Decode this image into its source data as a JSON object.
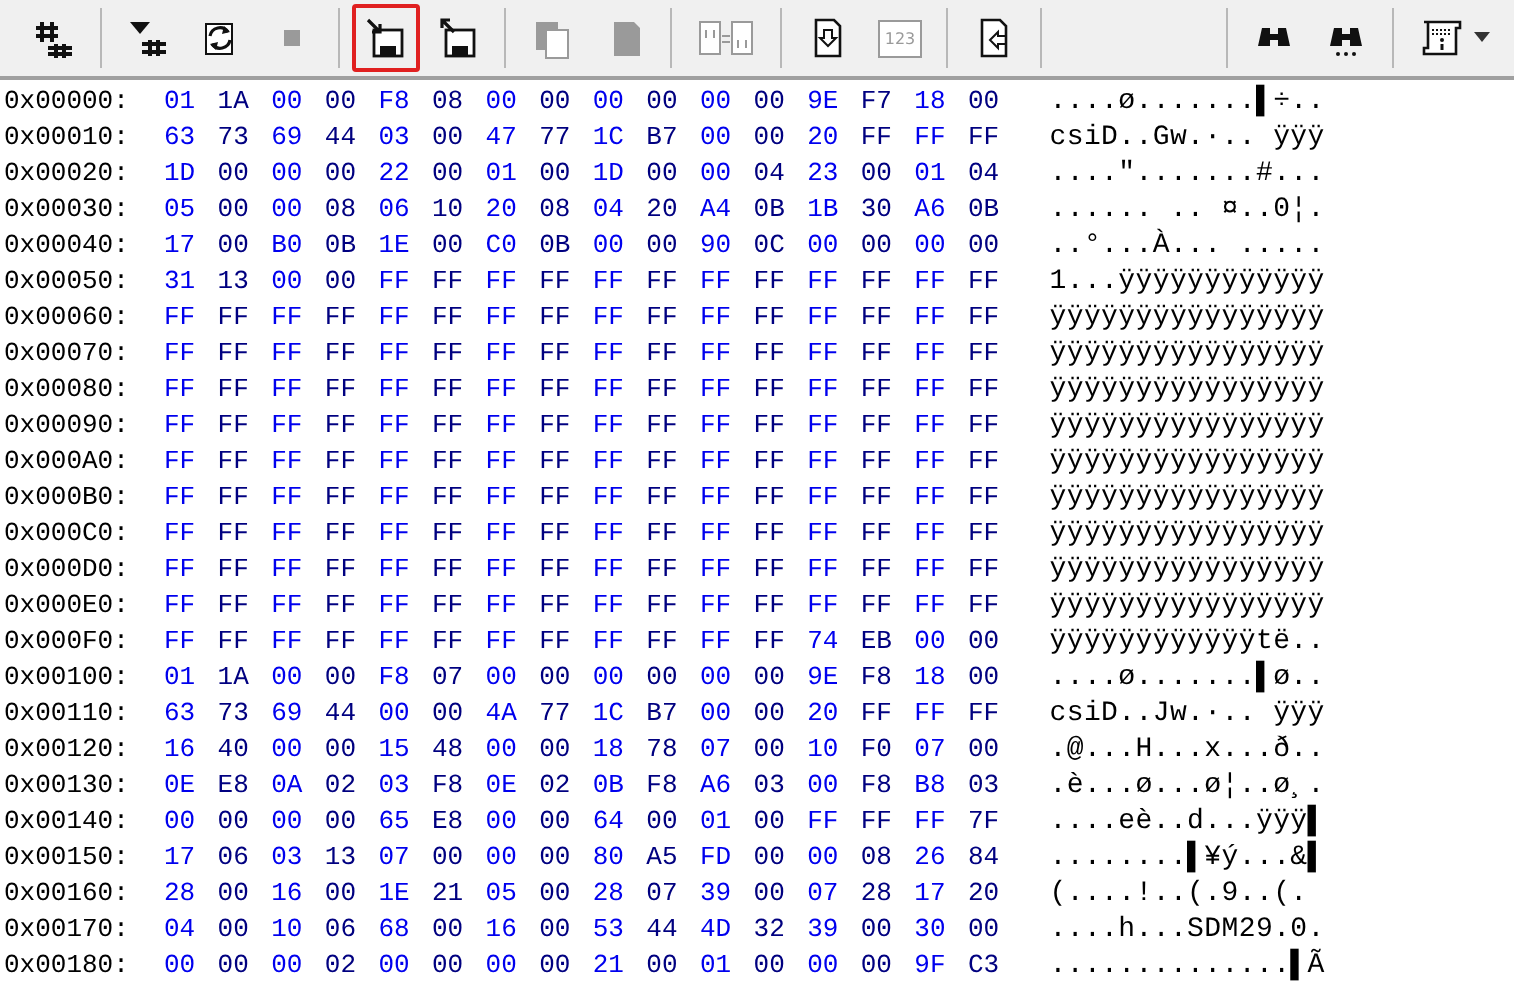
{
  "toolbar": {
    "groups": [
      {
        "buttons": [
          {
            "kind": "hash",
            "disabled": false,
            "highlighted": false
          }
        ]
      },
      {
        "buttons": [
          {
            "kind": "insert",
            "disabled": false,
            "highlighted": false
          },
          {
            "kind": "rotate",
            "disabled": false,
            "highlighted": false
          },
          {
            "kind": "stop",
            "disabled": true,
            "highlighted": false
          }
        ]
      },
      {
        "buttons": [
          {
            "kind": "save-in",
            "disabled": false,
            "highlighted": true
          },
          {
            "kind": "save-out",
            "disabled": false,
            "highlighted": false
          }
        ]
      },
      {
        "buttons": [
          {
            "kind": "copy",
            "disabled": true,
            "highlighted": false
          },
          {
            "kind": "paste",
            "disabled": true,
            "highlighted": false
          }
        ]
      },
      {
        "buttons": [
          {
            "kind": "compare",
            "disabled": true,
            "highlighted": false
          }
        ]
      },
      {
        "buttons": [
          {
            "kind": "doc-down",
            "disabled": false,
            "highlighted": false
          },
          {
            "kind": "numbers",
            "label": "123",
            "disabled": true,
            "highlighted": false
          }
        ]
      },
      {
        "buttons": [
          {
            "kind": "doc-left",
            "disabled": false,
            "highlighted": false
          }
        ]
      },
      {
        "spacer": true,
        "buttons": [
          {
            "kind": "binoculars",
            "disabled": false,
            "highlighted": false
          },
          {
            "kind": "binoculars-next",
            "disabled": false,
            "highlighted": false
          }
        ]
      },
      {
        "buttons": [
          {
            "kind": "info-scroll",
            "disabled": false,
            "highlighted": false,
            "dropdown": true
          }
        ]
      }
    ]
  },
  "rows": [
    {
      "offset": "0x00000:",
      "bytes": "01 1A 00 00 F8 08 00 00 00 00 00 00 9E F7 18 00",
      "text": "....ø.......▌÷.."
    },
    {
      "offset": "0x00010:",
      "bytes": "63 73 69 44 03 00 47 77 1C B7 00 00 20 FF FF FF",
      "text": "csiD..Gw.·.. ÿÿÿ"
    },
    {
      "offset": "0x00020:",
      "bytes": "1D 00 00 00 22 00 01 00 1D 00 00 04 23 00 01 04",
      "text": "....\".......#..."
    },
    {
      "offset": "0x00030:",
      "bytes": "05 00 00 08 06 10 20 08 04 20 A4 0B 1B 30 A6 0B",
      "text": "...... .. ¤..0¦."
    },
    {
      "offset": "0x00040:",
      "bytes": "17 00 B0 0B 1E 00 C0 0B 00 00 90 0C 00 00 00 00",
      "text": "..°...À... ....."
    },
    {
      "offset": "0x00050:",
      "bytes": "31 13 00 00 FF FF FF FF FF FF FF FF FF FF FF FF",
      "text": "1...ÿÿÿÿÿÿÿÿÿÿÿÿ"
    },
    {
      "offset": "0x00060:",
      "bytes": "FF FF FF FF FF FF FF FF FF FF FF FF FF FF FF FF",
      "text": "ÿÿÿÿÿÿÿÿÿÿÿÿÿÿÿÿ"
    },
    {
      "offset": "0x00070:",
      "bytes": "FF FF FF FF FF FF FF FF FF FF FF FF FF FF FF FF",
      "text": "ÿÿÿÿÿÿÿÿÿÿÿÿÿÿÿÿ"
    },
    {
      "offset": "0x00080:",
      "bytes": "FF FF FF FF FF FF FF FF FF FF FF FF FF FF FF FF",
      "text": "ÿÿÿÿÿÿÿÿÿÿÿÿÿÿÿÿ"
    },
    {
      "offset": "0x00090:",
      "bytes": "FF FF FF FF FF FF FF FF FF FF FF FF FF FF FF FF",
      "text": "ÿÿÿÿÿÿÿÿÿÿÿÿÿÿÿÿ"
    },
    {
      "offset": "0x000A0:",
      "bytes": "FF FF FF FF FF FF FF FF FF FF FF FF FF FF FF FF",
      "text": "ÿÿÿÿÿÿÿÿÿÿÿÿÿÿÿÿ"
    },
    {
      "offset": "0x000B0:",
      "bytes": "FF FF FF FF FF FF FF FF FF FF FF FF FF FF FF FF",
      "text": "ÿÿÿÿÿÿÿÿÿÿÿÿÿÿÿÿ"
    },
    {
      "offset": "0x000C0:",
      "bytes": "FF FF FF FF FF FF FF FF FF FF FF FF FF FF FF FF",
      "text": "ÿÿÿÿÿÿÿÿÿÿÿÿÿÿÿÿ"
    },
    {
      "offset": "0x000D0:",
      "bytes": "FF FF FF FF FF FF FF FF FF FF FF FF FF FF FF FF",
      "text": "ÿÿÿÿÿÿÿÿÿÿÿÿÿÿÿÿ"
    },
    {
      "offset": "0x000E0:",
      "bytes": "FF FF FF FF FF FF FF FF FF FF FF FF FF FF FF FF",
      "text": "ÿÿÿÿÿÿÿÿÿÿÿÿÿÿÿÿ"
    },
    {
      "offset": "0x000F0:",
      "bytes": "FF FF FF FF FF FF FF FF FF FF FF FF 74 EB 00 00",
      "text": "ÿÿÿÿÿÿÿÿÿÿÿÿtë.."
    },
    {
      "offset": "0x00100:",
      "bytes": "01 1A 00 00 F8 07 00 00 00 00 00 00 9E F8 18 00",
      "text": "....ø.......▌ø.."
    },
    {
      "offset": "0x00110:",
      "bytes": "63 73 69 44 00 00 4A 77 1C B7 00 00 20 FF FF FF",
      "text": "csiD..Jw.·.. ÿÿÿ"
    },
    {
      "offset": "0x00120:",
      "bytes": "16 40 00 00 15 48 00 00 18 78 07 00 10 F0 07 00",
      "text": ".@...H...x...ð.."
    },
    {
      "offset": "0x00130:",
      "bytes": "0E E8 0A 02 03 F8 0E 02 0B F8 A6 03 00 F8 B8 03",
      "text": ".è...ø...ø¦..ø¸."
    },
    {
      "offset": "0x00140:",
      "bytes": "00 00 00 00 65 E8 00 00 64 00 01 00 FF FF FF 7F",
      "text": "....eè..d...ÿÿÿ▌"
    },
    {
      "offset": "0x00150:",
      "bytes": "17 06 03 13 07 00 00 00 80 A5 FD 00 00 08 26 84",
      "text": "........▌¥ý...&▌"
    },
    {
      "offset": "0x00160:",
      "bytes": "28 00 16 00 1E 21 05 00 28 07 39 00 07 28 17 20",
      "text": "(....!..(.9..(. "
    },
    {
      "offset": "0x00170:",
      "bytes": "04 00 10 06 68 00 16 00 53 44 4D 32 39 00 30 00",
      "text": "....h...SDM29.0."
    },
    {
      "offset": "0x00180:",
      "bytes": "00 00 00 02 00 00 00 00 21 00 01 00 00 00 9F C3",
      "text": "..............▌Ã"
    }
  ]
}
